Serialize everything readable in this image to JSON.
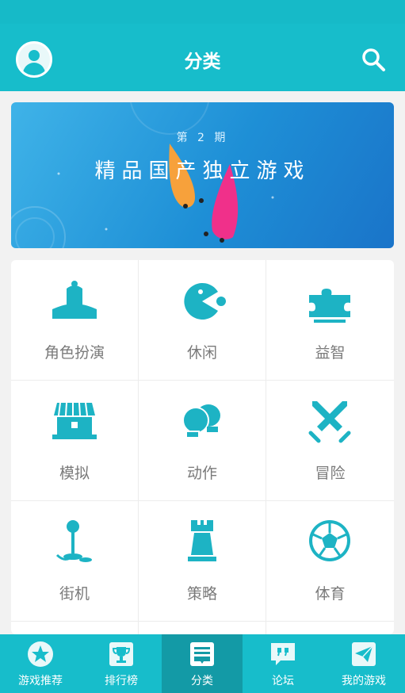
{
  "header": {
    "title": "分类"
  },
  "banner": {
    "issue": "第 2 期",
    "headline": "精品国产独立游戏"
  },
  "categories": [
    {
      "label": "角色扮演",
      "icon": "rpg-figure-icon"
    },
    {
      "label": "休闲",
      "icon": "pacman-icon"
    },
    {
      "label": "益智",
      "icon": "puzzle-icon"
    },
    {
      "label": "模拟",
      "icon": "shop-icon"
    },
    {
      "label": "动作",
      "icon": "boxing-gloves-icon"
    },
    {
      "label": "冒险",
      "icon": "crossed-swords-icon"
    },
    {
      "label": "街机",
      "icon": "joystick-icon"
    },
    {
      "label": "策略",
      "icon": "chess-rook-icon"
    },
    {
      "label": "体育",
      "icon": "soccer-ball-icon"
    }
  ],
  "tabs": [
    {
      "label": "游戏推荐",
      "icon": "star-icon"
    },
    {
      "label": "排行榜",
      "icon": "trophy-icon"
    },
    {
      "label": "分类",
      "icon": "category-list-icon"
    },
    {
      "label": "论坛",
      "icon": "quote-bubble-icon"
    },
    {
      "label": "我的游戏",
      "icon": "paper-plane-icon"
    }
  ],
  "colors": {
    "primary": "#17bdcb",
    "active_tab": "#139aa6",
    "icon": "#1db3c4",
    "label": "#7a7a7a"
  }
}
